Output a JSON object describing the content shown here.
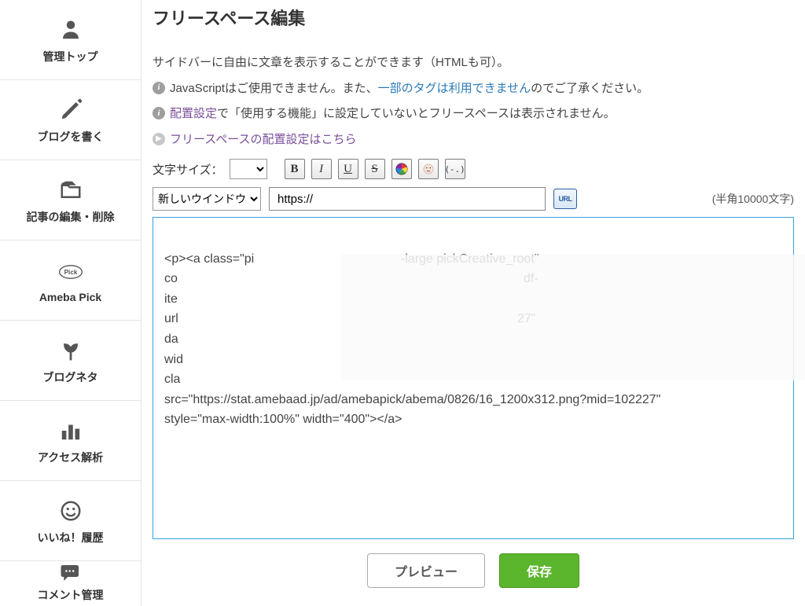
{
  "sidebar": {
    "items": [
      {
        "label": "管理トップ",
        "icon": "user"
      },
      {
        "label": "ブログを書く",
        "icon": "pencil"
      },
      {
        "label": "記事の編集・削除",
        "icon": "folder"
      },
      {
        "label": "Ameba Pick",
        "icon": "pick"
      },
      {
        "label": "ブログネタ",
        "icon": "seed"
      },
      {
        "label": "アクセス解析",
        "icon": "bars"
      },
      {
        "label": "いいね！履歴",
        "icon": "smile"
      },
      {
        "label": "コメント管理",
        "icon": "comment"
      }
    ]
  },
  "page": {
    "title": "フリースペース編集",
    "desc1": "サイドバーに自由に文章を表示することができます（HTMLも可）。",
    "desc2_pre": "JavaScriptはご使用できません。また、",
    "desc2_link": "一部のタグは利用できません",
    "desc2_post": "のでご了承ください。",
    "desc3_link": "配置設定",
    "desc3_post": "で「使用する機能」に設定していないとフリースペースは表示されません。",
    "desc4_link": "フリースペースの配置設定はこちら"
  },
  "toolbar": {
    "size_label": "文字サイズ：",
    "size_value": "",
    "buttons": {
      "bold": "B",
      "italic": "I",
      "underline": "U",
      "strike": "S"
    }
  },
  "link_row": {
    "target_value": "新しいウインドウ",
    "url_value": "https://",
    "url_btn": "URL",
    "count_label": "(半角10000文字)"
  },
  "editor": {
    "content": "<p><a class=\"pickCreative_root\" co df-ite url 27\" da wid cla src=\"https://stat.amebaad.jp/ad/amebapick/abema/0826/16_1200x312.png?mid=102227\" style=\"max-width:100%\" width=\"400\"></a>"
  },
  "editor_display": {
    "l1": "<p><a class=\"pi                                          -large pickCreative_root\"",
    "l2": "co                                                                                                   df-",
    "l3": "ite",
    "l4": "url                                                                                                 27\"",
    "l5": "da",
    "l6": "wid",
    "l7": "cla",
    "l8": "src=\"https://stat.amebaad.jp/ad/amebapick/abema/0826/16_1200x312.png?mid=102227\"",
    "l9": "style=\"max-width:100%\" width=\"400\"></a>"
  },
  "actions": {
    "preview": "プレビュー",
    "save": "保存"
  }
}
